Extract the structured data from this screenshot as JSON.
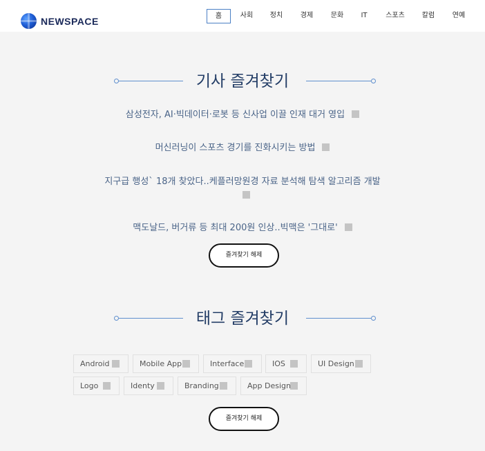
{
  "brand": {
    "name": "NEWSPACE"
  },
  "nav": {
    "items": [
      "홈",
      "사회",
      "정치",
      "경제",
      "문화",
      "IT",
      "스포츠",
      "칼럼",
      "연예"
    ],
    "active": "홈"
  },
  "articles_section": {
    "title": "기사 즐겨찾기",
    "items": [
      "삼성전자, AI·빅데이터·로봇 등 신사업 이끌 인재 대거 영입",
      "머신러닝이 스포츠 경기를 진화시키는 방법",
      "지구급 행성` 18개 찾았다..케플러망원경 자료 분석해 탐색 알고리즘 개발",
      "맥도날드, 버거류 등 최대 200원 인상..빅맥은 '그대로'"
    ],
    "clear_label": "즐겨찾기 해제"
  },
  "tags_section": {
    "title": "태그 즐겨찾기",
    "tags": [
      "Android",
      "Mobile App",
      "Interface",
      "IOS",
      "UI Design",
      "Logo",
      "Identy",
      "Branding",
      "App Design"
    ],
    "clear_label": "즐겨찾기 해제"
  },
  "colors": {
    "accent": "#5f8fce",
    "title": "#233d66",
    "link": "#4a6488",
    "background": "#f4f4f4"
  }
}
